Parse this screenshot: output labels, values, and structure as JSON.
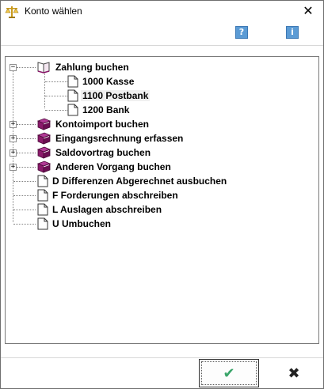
{
  "window": {
    "title": "Konto wählen",
    "close_glyph": "✕"
  },
  "toolbar": {
    "help_glyph": "?",
    "info_glyph": "i"
  },
  "tree": {
    "items": [
      {
        "label": "Zahlung buchen",
        "icon": "open-book-icon",
        "expanded": true
      },
      {
        "label": "1000 Kasse",
        "icon": "document-icon"
      },
      {
        "label": "1100 Postbank",
        "icon": "document-icon",
        "selected": true
      },
      {
        "label": "1200 Bank",
        "icon": "document-icon"
      },
      {
        "label": "Kontoimport buchen",
        "icon": "book-icon",
        "expanded": false
      },
      {
        "label": "Eingangsrechnung erfassen",
        "icon": "book-icon",
        "expanded": false
      },
      {
        "label": "Saldovortrag buchen",
        "icon": "book-icon",
        "expanded": false
      },
      {
        "label": "Anderen Vorgang buchen",
        "icon": "book-icon",
        "expanded": false
      },
      {
        "label": "D Differenzen Abgerechnet ausbuchen",
        "icon": "document-icon"
      },
      {
        "label": "F Forderungen abschreiben",
        "icon": "document-icon"
      },
      {
        "label": "L Auslagen abschreiben",
        "icon": "document-icon"
      },
      {
        "label": "U Umbuchen",
        "icon": "document-icon"
      }
    ],
    "expander_minus": "−",
    "expander_plus": "+"
  },
  "buttons": {
    "ok_glyph": "✔",
    "cancel_glyph": "✖"
  },
  "colors": {
    "book": "#8b1a6b",
    "check": "#3aa56a",
    "help_button": "#5b9bd5"
  }
}
